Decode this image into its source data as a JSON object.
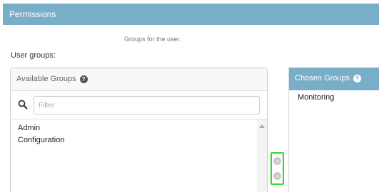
{
  "section": {
    "title": "Permissions"
  },
  "field": {
    "help_text": "Groups for the user.",
    "label": "User groups:"
  },
  "available": {
    "title": "Available Groups",
    "help_icon": "question-circle-icon",
    "filter_placeholder": "Filter",
    "search_icon": "search-icon",
    "options": [
      "Admin",
      "Configuration"
    ]
  },
  "chosen": {
    "title": "Chosen Groups",
    "help_icon": "question-circle-icon",
    "options": [
      "Monitoring"
    ]
  },
  "move_buttons": {
    "add_icon": "arrow-right-circle-icon",
    "remove_icon": "arrow-left-circle-icon"
  },
  "colors": {
    "header_bg": "#79aec8",
    "highlight_border": "#36d63a"
  }
}
